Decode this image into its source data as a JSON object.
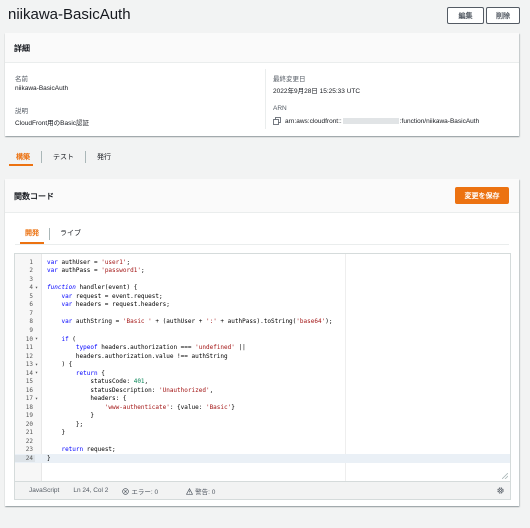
{
  "header": {
    "title": "niikawa-BasicAuth",
    "edit_label": "編集",
    "delete_label": "削除"
  },
  "details": {
    "heading": "詳細",
    "name_label": "名前",
    "name_value": "niikawa-BasicAuth",
    "desc_label": "説明",
    "desc_value": "CloudFront用のBasic認証",
    "modified_label": "最終変更日",
    "modified_value": "2022年9月28日 15:25:33 UTC",
    "arn_label": "ARN",
    "arn_prefix": "arn:aws:cloudfront::",
    "arn_suffix": ":function/niikawa-BasicAuth"
  },
  "tabs": [
    "構築",
    "テスト",
    "発行"
  ],
  "code": {
    "heading": "関数コード",
    "save_label": "変更を保存",
    "inner_tabs": [
      "開発",
      "ライブ"
    ],
    "lines": [
      "var authUser = 'user1';",
      "var authPass = 'password1';",
      "",
      "function handler(event) {",
      "    var request = event.request;",
      "    var headers = request.headers;",
      "",
      "    var authString = 'Basic ' + (authUser + ':' + authPass).toString('base64');",
      "",
      "    if (",
      "        typeof headers.authorization === 'undefined' ||",
      "        headers.authorization.value !== authString",
      "    ) {",
      "        return {",
      "            statusCode: 401,",
      "            statusDescription: 'Unauthorized',",
      "            headers: {",
      "                'www-authenticate': {value: 'Basic'}",
      "            }",
      "        };",
      "    }",
      "",
      "    return request;",
      "}"
    ]
  },
  "status": {
    "language": "JavaScript",
    "position": "Ln 24, Col 2",
    "errors": "エラー: 0",
    "warnings": "警告: 0"
  }
}
